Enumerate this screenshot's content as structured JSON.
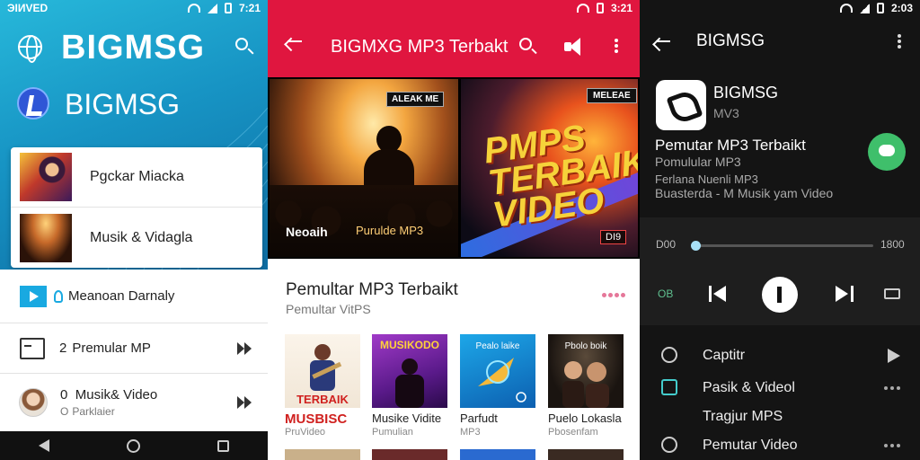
{
  "screen1": {
    "status_left": "ЭІИVED",
    "status_time": "7:21",
    "title": "BIGMSG",
    "subtitle": "BIGMSG",
    "card_items": [
      {
        "label": "Pgckar Miacka"
      },
      {
        "label": "Musik & Vidagla"
      }
    ],
    "list_items": [
      {
        "label": "Meanoan Darnaly"
      },
      {
        "label": "Premular MP",
        "prefix": "2"
      },
      {
        "label": "Musik& Video",
        "prefix": "0",
        "sub": "Parklaier",
        "sub_prefix": "O"
      }
    ]
  },
  "screen2": {
    "status_time": "3:21",
    "title": "BIGMXG MP3 Terbakt",
    "banner_left": {
      "tag": "ALEAK ME",
      "caption": "Neoaih",
      "caption2": "Purulde MP3"
    },
    "banner_right": {
      "tag": "MELEAE",
      "art_text": [
        "PMPS",
        "TERBAIK",
        "VIDEO"
      ],
      "badge": "DI9"
    },
    "section_title": "Pemultar MP3 Terbaikt",
    "section_subtitle": "Pemultar VitPS",
    "tiles": [
      {
        "label": "MUSBISC",
        "sub": "PruVideo",
        "art": "TERBAIK"
      },
      {
        "label": "Musike Vidite",
        "sub": "Pumulian",
        "art": "MUSIKODO"
      },
      {
        "label": "Parfudt",
        "sub": "MP3",
        "art": "Pealo laike"
      },
      {
        "label": "Puelo Lokasla",
        "sub": "Pbosenfam",
        "art": "Pbolo boik"
      }
    ]
  },
  "screen3": {
    "status_time": "2:03",
    "title": "BIGMSG",
    "app_name": "BIGMSG",
    "app_sub": "MV3",
    "track_title": "Pemutar MP3 Terbaikt",
    "track_sub": "Pomulular MP3",
    "track_desc1": "Ferlana Nuenli MP3",
    "track_desc2": "Buasterda - M Musik yam Video",
    "time_start": "D00",
    "time_end": "1800",
    "progress": 0.02,
    "repeat_label": "OB",
    "menu": [
      {
        "label": "Captitr",
        "trailing": "play"
      },
      {
        "label": "Pasik & Videol",
        "trailing": "more"
      },
      {
        "label": "Tragjur MPS",
        "trailing": "none"
      },
      {
        "label": "Pemutar Video",
        "trailing": "more"
      }
    ]
  },
  "colors": {
    "accent_red": "#e0163f",
    "accent_blue": "#19a9e1",
    "accent_green": "#3fbf6b"
  }
}
